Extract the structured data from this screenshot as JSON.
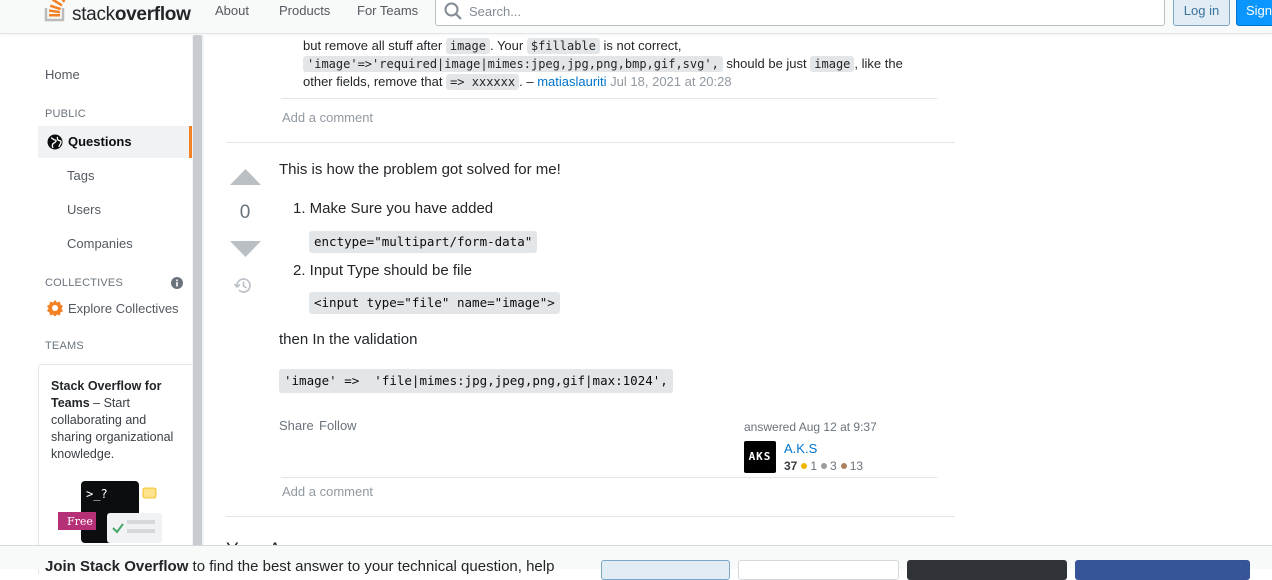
{
  "header": {
    "logo_word_light": "stack",
    "logo_word_bold": "overflow",
    "nav": [
      "About",
      "Products",
      "For Teams"
    ],
    "search_placeholder": "Search...",
    "login_label": "Log in",
    "signup_label": "Sign"
  },
  "sidebar": {
    "home": "Home",
    "public_label": "PUBLIC",
    "questions": "Questions",
    "items": [
      "Tags",
      "Users",
      "Companies"
    ],
    "collectives_label": "COLLECTIVES",
    "explore_collectives": "Explore Collectives",
    "teams_label": "TEAMS",
    "teams_card": {
      "title": "Stack Overflow for Teams",
      "body": " – Start collaborating and sharing organizational knowledge.",
      "free_badge": "Free"
    }
  },
  "comment": {
    "line1_pre": "but remove all stuff after ",
    "line1_code1": "image",
    "line1_mid": ". Your ",
    "line1_code2": "$fillable",
    "line1_post": " is not correct,",
    "line2_code": "'image'=>'required|image|mimes:jpeg,jpg,png,bmp,gif,svg',",
    "line2_mid": " should be just ",
    "line2_code2": "image",
    "line2_post": ", like the",
    "line3_pre": "other fields, remove that ",
    "line3_code": "=> xxxxxx",
    "line3_post": ". – ",
    "author": "matiaslauriti",
    "timestamp": "Jul 18, 2021 at 20:28"
  },
  "add_comment_label": "Add a comment",
  "answer": {
    "score": "0",
    "intro": "This is how the problem got solved for me!",
    "step1": "1. Make Sure you have added",
    "code1": "enctype=\"multipart/form-data\"",
    "step2": "2. Input Type should be file",
    "code2": "<input type=\"file\" name=\"image\">",
    "then_text": "then In the validation",
    "code3": "'image' =>  'file|mimes:jpg,jpeg,png,gif|max:1024',",
    "share": "Share",
    "follow": "Follow",
    "answered_label": "answered Aug 12 at 9:37",
    "user": {
      "avatar_text": "AKS",
      "name": "A.K.S",
      "reputation": "37",
      "gold": "1",
      "silver": "3",
      "bronze": "13"
    }
  },
  "your_answer_heading": "Your Answer",
  "banner": {
    "bold": "Join Stack Overflow",
    "rest": " to find the best answer to your technical question, help"
  },
  "colors": {
    "accent_orange": "#f48225",
    "link_blue": "#0074cc",
    "gold_badge": "#f1b600",
    "silver_badge": "#9a9c9f",
    "bronze_badge": "#ab825f"
  }
}
